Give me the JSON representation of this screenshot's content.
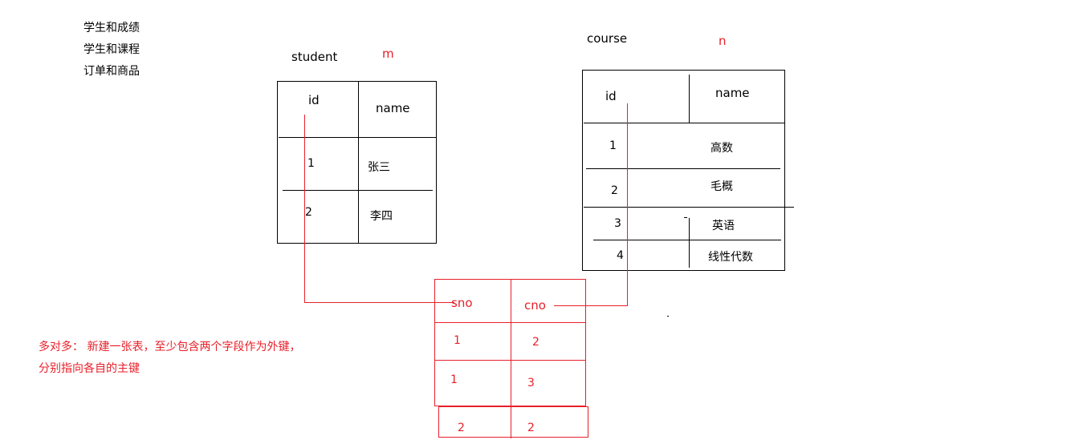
{
  "examples": [
    "学生和成绩",
    "学生和课程",
    "订单和商品"
  ],
  "student": {
    "title": "student",
    "cardinality": "m",
    "headers": [
      "id",
      "name"
    ],
    "rows": [
      [
        "1",
        "张三"
      ],
      [
        "2",
        "李四"
      ]
    ]
  },
  "course": {
    "title": "course",
    "cardinality": "n",
    "headers": [
      "id",
      "name"
    ],
    "rows": [
      [
        "1",
        "高数"
      ],
      [
        "2",
        "毛概"
      ],
      [
        "3",
        "英语"
      ],
      [
        "4",
        "线性代数"
      ]
    ]
  },
  "join_table": {
    "headers": [
      "sno",
      "cno"
    ],
    "rows": [
      [
        "1",
        "2"
      ],
      [
        "1",
        "3"
      ],
      [
        "2",
        "2"
      ]
    ]
  },
  "note": {
    "line1": "多对多： 新建一张表，至少包含两个字段作为外键，",
    "line2": "分别指向各自的主键"
  },
  "colors": {
    "annotation": "#e8202a",
    "ink": "#000000"
  }
}
